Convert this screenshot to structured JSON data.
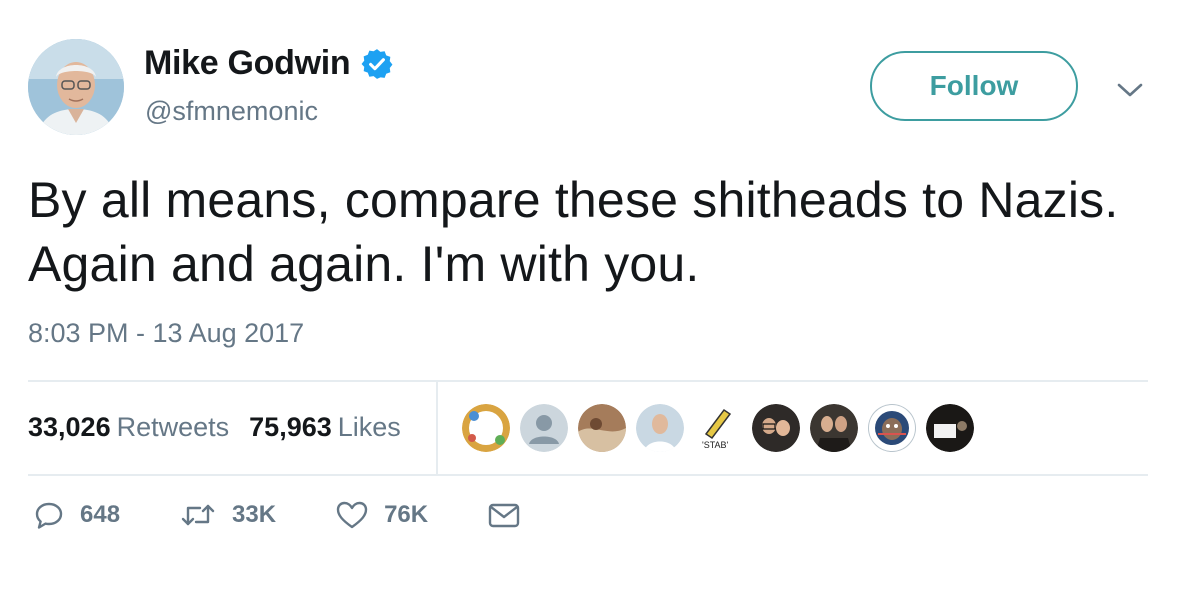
{
  "author": {
    "name": "Mike Godwin",
    "handle": "@sfmnemonic",
    "avatar_icon": "user-avatar-photo",
    "verified_icon": "verified-badge-icon"
  },
  "follow_button": {
    "label": "Follow"
  },
  "menu_icon": "chevron-down-icon",
  "tweet": {
    "text": "By all means, compare these shitheads to Nazis. Again and again. I'm with you.",
    "timestamp": "8:03 PM - 13 Aug 2017"
  },
  "stats": {
    "retweets_count": "33,026",
    "retweets_label": "Retweets",
    "likes_count": "75,963",
    "likes_label": "Likes"
  },
  "likers": {
    "avatars": [
      "liker-avatar",
      "liker-avatar",
      "liker-avatar",
      "liker-avatar",
      "liker-avatar",
      "liker-avatar",
      "liker-avatar",
      "liker-avatar",
      "liker-avatar"
    ],
    "avatar_text": "'STAB'"
  },
  "actions": {
    "reply": {
      "icon": "reply-icon",
      "count": "648"
    },
    "retweet": {
      "icon": "retweet-icon",
      "count": "33K"
    },
    "like": {
      "icon": "heart-icon",
      "count": "76K"
    },
    "message": {
      "icon": "envelope-icon"
    }
  },
  "colors": {
    "accent": "#3d9da0",
    "verified": "#1da1f2",
    "muted_text": "#657786",
    "primary_text": "#14171a",
    "divider": "#e6ecf0"
  }
}
